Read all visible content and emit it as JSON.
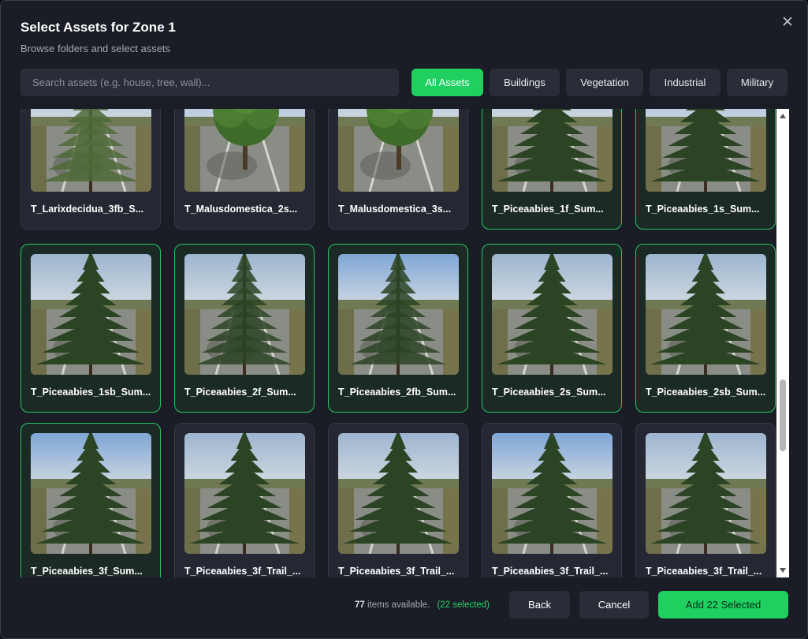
{
  "dialog": {
    "title": "Select Assets for Zone 1",
    "subtitle": "Browse folders and select assets"
  },
  "search": {
    "placeholder": "Search assets (e.g. house, tree, wall)...",
    "value": ""
  },
  "filters": [
    {
      "label": "All Assets",
      "active": true
    },
    {
      "label": "Buildings",
      "active": false
    },
    {
      "label": "Vegetation",
      "active": false
    },
    {
      "label": "Industrial",
      "active": false
    },
    {
      "label": "Military",
      "active": false
    }
  ],
  "assets": [
    {
      "label": "T_Larixdecidua_3fb_S...",
      "selected": false,
      "kind": "larch"
    },
    {
      "label": "T_Malusdomestica_2s...",
      "selected": false,
      "kind": "apple"
    },
    {
      "label": "T_Malusdomestica_3s...",
      "selected": false,
      "kind": "apple"
    },
    {
      "label": "T_Piceaabies_1f_Sum...",
      "selected": true,
      "kind": "spruce"
    },
    {
      "label": "T_Piceaabies_1s_Sum...",
      "selected": true,
      "kind": "spruce"
    },
    {
      "label": "T_Piceaabies_1sb_Sum...",
      "selected": true,
      "kind": "spruce"
    },
    {
      "label": "T_Piceaabies_2f_Sum...",
      "selected": true,
      "kind": "spruce-sparse"
    },
    {
      "label": "T_Piceaabies_2fb_Sum...",
      "selected": true,
      "kind": "spruce-sparse"
    },
    {
      "label": "T_Piceaabies_2s_Sum...",
      "selected": true,
      "kind": "spruce"
    },
    {
      "label": "T_Piceaabies_2sb_Sum...",
      "selected": true,
      "kind": "spruce"
    },
    {
      "label": "T_Piceaabies_3f_Sum...",
      "selected": true,
      "kind": "spruce"
    },
    {
      "label": "T_Piceaabies_3f_Trail_...",
      "selected": false,
      "kind": "spruce"
    },
    {
      "label": "T_Piceaabies_3f_Trail_...",
      "selected": false,
      "kind": "spruce"
    },
    {
      "label": "T_Piceaabies_3f_Trail_...",
      "selected": false,
      "kind": "spruce"
    },
    {
      "label": "T_Piceaabies_3f_Trail_...",
      "selected": false,
      "kind": "spruce"
    }
  ],
  "footer": {
    "count": "77",
    "items_text": "items available.",
    "selected_text": "(22 selected)",
    "back_label": "Back",
    "cancel_label": "Cancel",
    "add_label": "Add 22 Selected"
  },
  "colors": {
    "accent": "#1fcf60",
    "selected_border": "#27c560",
    "background": "#1a1d26"
  }
}
